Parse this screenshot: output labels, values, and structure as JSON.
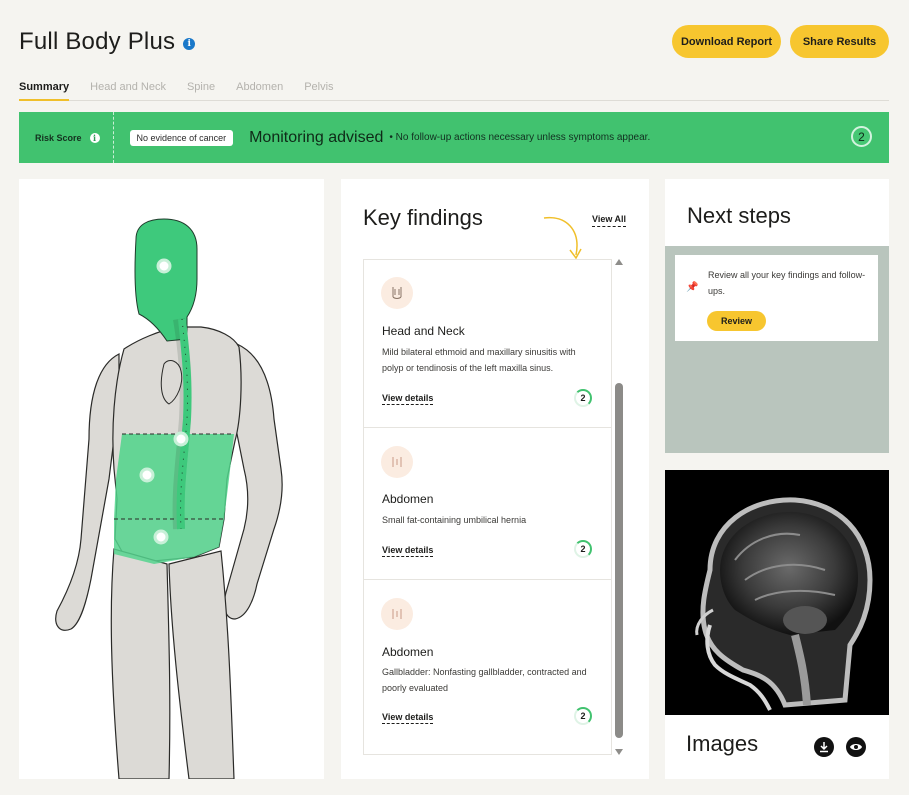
{
  "header": {
    "title": "Full Body Plus",
    "info_icon": "info-icon",
    "download_label": "Download Report",
    "share_label": "Share Results"
  },
  "tabs": [
    {
      "label": "Summary",
      "active": true
    },
    {
      "label": "Head and Neck",
      "active": false
    },
    {
      "label": "Spine",
      "active": false
    },
    {
      "label": "Abdomen",
      "active": false
    },
    {
      "label": "Pelvis",
      "active": false
    }
  ],
  "risk": {
    "label": "Risk Score",
    "badge": "No evidence of cancer",
    "headline": "Monitoring advised",
    "note": "• No follow-up actions necessary unless symptoms appear.",
    "count": "2",
    "color": "#41c26f"
  },
  "findings": {
    "title": "Key findings",
    "view_all": "View All",
    "items": [
      {
        "title": "Head and Neck",
        "desc": "Mild bilateral ethmoid and maxillary sinusitis with polyp or tendinosis of the left maxilla sinus.",
        "link": "View details",
        "count": "2",
        "icon": "neck-icon"
      },
      {
        "title": "Abdomen",
        "desc": "Small fat-containing umbilical hernia",
        "link": "View details",
        "count": "2",
        "icon": "abdomen-icon"
      },
      {
        "title": "Abdomen",
        "desc": "Gallbladder: Nonfasting gallbladder, contracted and poorly evaluated",
        "link": "View details",
        "count": "2",
        "icon": "abdomen-icon"
      }
    ]
  },
  "next_steps": {
    "title": "Next steps",
    "text": "Review all your key findings and follow-ups.",
    "button": "Review"
  },
  "images": {
    "title": "Images",
    "download_icon": "download-icon",
    "view_icon": "eye-icon"
  },
  "colors": {
    "accent_yellow": "#f7c62f",
    "highlight_green": "#41c26f",
    "body_gray": "#dedcd8"
  }
}
